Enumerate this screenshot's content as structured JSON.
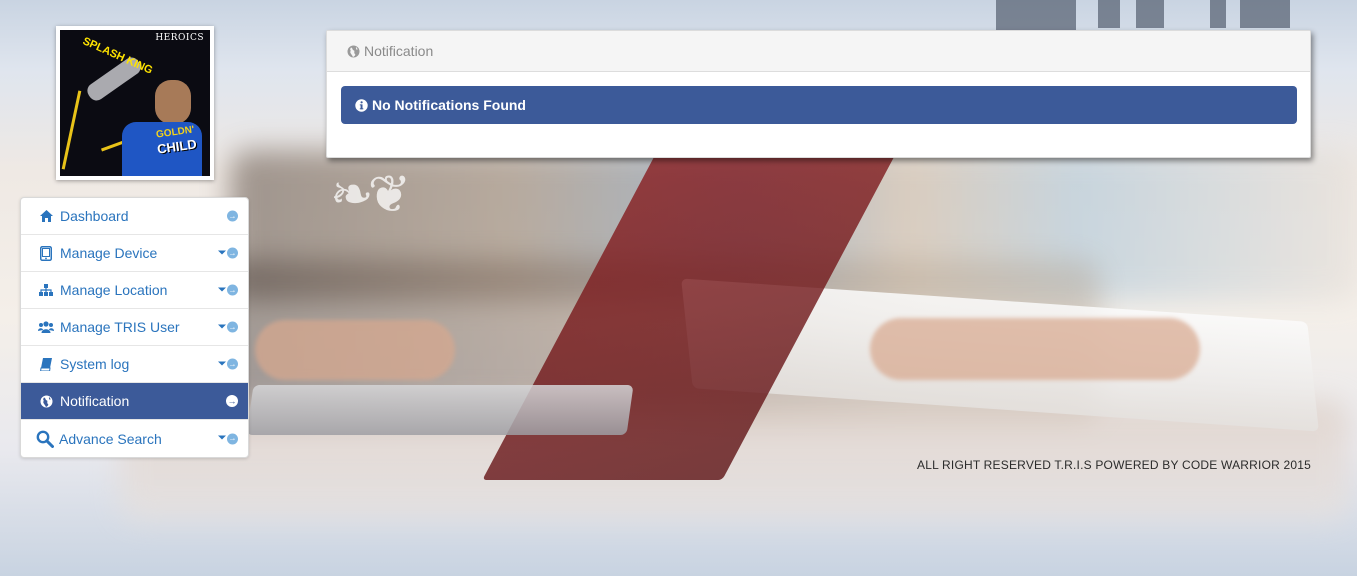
{
  "profile": {
    "image_brand": "HEROICS",
    "image_text_top": "SPLASH KING",
    "image_text_1": "GOLDN'",
    "image_text_2": "CHILD"
  },
  "sidebar": {
    "items": [
      {
        "label": "Dashboard",
        "icon": "home-icon",
        "has_caret": false
      },
      {
        "label": "Manage Device",
        "icon": "tablet-icon",
        "has_caret": true
      },
      {
        "label": "Manage Location",
        "icon": "sitemap-icon",
        "has_caret": true
      },
      {
        "label": "Manage TRIS User",
        "icon": "users-icon",
        "has_caret": true
      },
      {
        "label": "System log",
        "icon": "book-icon",
        "has_caret": true
      },
      {
        "label": "Notification",
        "icon": "globe-icon",
        "has_caret": false,
        "active": true
      },
      {
        "label": "Advance Search",
        "icon": "search-icon",
        "has_caret": true
      }
    ]
  },
  "panel": {
    "heading": "Notification",
    "alert_text": "No Notifications Found"
  },
  "footer": {
    "text": "ALL RIGHT RESERVED T.R.I.S POWERED BY CODE WARRIOR 2015"
  },
  "colors": {
    "accent": "#3c5a99",
    "link": "#2a74bd",
    "arrow": "#7fb5e1"
  }
}
